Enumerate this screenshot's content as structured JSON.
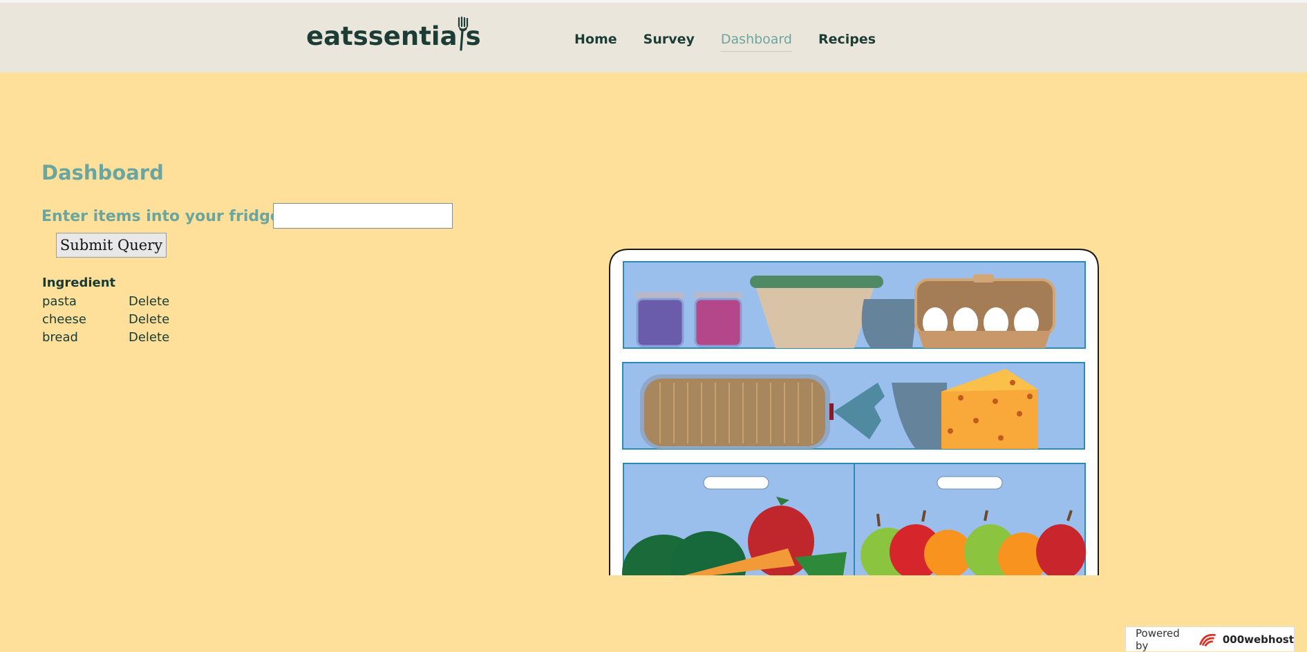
{
  "header": {
    "logo_text": "eatssentials",
    "nav": [
      {
        "label": "Home",
        "active": false
      },
      {
        "label": "Survey",
        "active": false
      },
      {
        "label": "Dashboard",
        "active": true
      },
      {
        "label": "Recipes",
        "active": false
      }
    ]
  },
  "main": {
    "title": "Dashboard",
    "input_label": "Enter items into your fridge here:",
    "input_value": "",
    "submit_label": "Submit Query",
    "table": {
      "header": "Ingredient",
      "rows": [
        {
          "name": "pasta",
          "action": "Delete"
        },
        {
          "name": "cheese",
          "action": "Delete"
        },
        {
          "name": "bread",
          "action": "Delete"
        }
      ]
    }
  },
  "footer": {
    "powered_prefix": "Powered by",
    "powered_brand": "000webhost"
  },
  "colors": {
    "background": "#ffe09a",
    "header_bg": "#ebe6db",
    "accent": "#6aa69f",
    "dark_text": "#1c3d36"
  },
  "icons": {
    "logo": "fork-icon",
    "footer": "000webhost-logo-icon"
  }
}
